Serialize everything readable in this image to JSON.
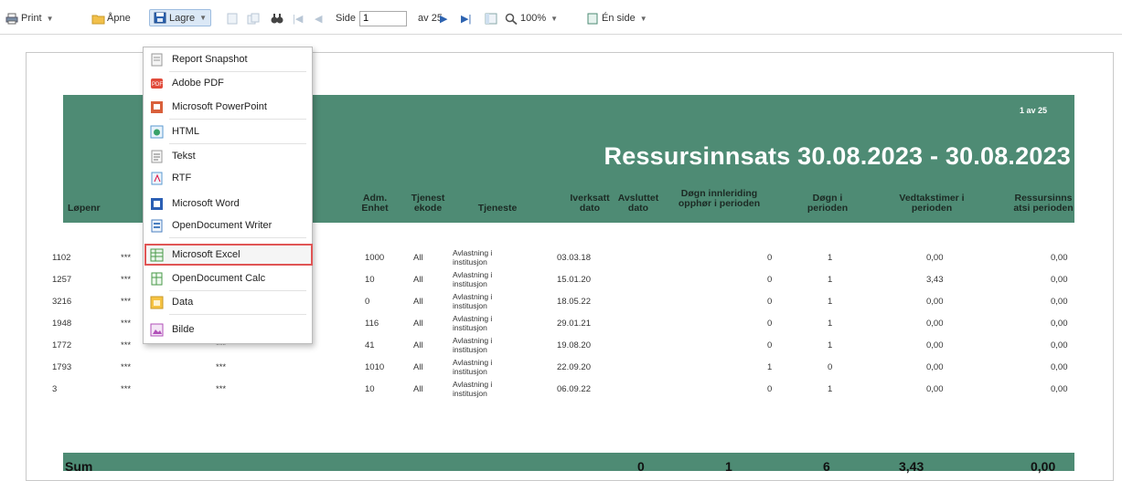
{
  "toolbar": {
    "print_label": "Print",
    "open_label": "Åpne",
    "save_label": "Lagre",
    "page_prefix": "Side",
    "page_value": "1",
    "page_of": "av 25",
    "zoom_label": "100%",
    "view_label": "Én side"
  },
  "export_menu": {
    "items": [
      {
        "label": "Report Snapshot",
        "icon": "snapshot-icon"
      },
      {
        "label": "Adobe PDF",
        "icon": "pdf-icon"
      },
      {
        "label": "Microsoft PowerPoint",
        "icon": "powerpoint-icon"
      },
      {
        "label": "HTML",
        "icon": "html-icon"
      },
      {
        "label": "Tekst",
        "icon": "text-icon"
      },
      {
        "label": "RTF",
        "icon": "rtf-icon"
      },
      {
        "label": "Microsoft Word",
        "icon": "word-icon"
      },
      {
        "label": "OpenDocument Writer",
        "icon": "odt-icon"
      },
      {
        "label": "Microsoft Excel",
        "icon": "excel-icon"
      },
      {
        "label": "OpenDocument Calc",
        "icon": "ods-icon"
      },
      {
        "label": "Data",
        "icon": "data-icon"
      },
      {
        "label": "Bilde",
        "icon": "image-icon"
      }
    ]
  },
  "report": {
    "page_indicator": "1 av 25",
    "title": "Ressursinnsats 30.08.2023 - 30.08.2023",
    "columns": {
      "lopenr": "Løpenr",
      "adm_enhet": "Adm. Enhet",
      "tjenestekode": "Tjenest ekode",
      "tjeneste": "Tjeneste",
      "iverksatt": "Iverksatt dato",
      "avsluttet": "Avsluttet dato",
      "dogn_opphor": "Døgn innleriding opphør i perioden",
      "dogn_perioden": "Døgn i perioden",
      "vedtakstimer": "Vedtakstimer i perioden",
      "ressursinnsats": "Ressursinns atsi perioden"
    },
    "rows": [
      {
        "lopenr": "1102",
        "c2": "***",
        "c3": "",
        "adm": "1000",
        "kode": "All",
        "tj": "Avlastning i institusjon",
        "ivd": "03.03.18",
        "avd": "",
        "opph": "0",
        "dogn": "1",
        "vt": "0,00",
        "ri": "0,00"
      },
      {
        "lopenr": "1257",
        "c2": "***",
        "c3": "",
        "adm": "10",
        "kode": "All",
        "tj": "Avlastning i institusjon",
        "ivd": "15.01.20",
        "avd": "",
        "opph": "0",
        "dogn": "1",
        "vt": "3,43",
        "ri": "0,00"
      },
      {
        "lopenr": "3216",
        "c2": "***",
        "c3": "",
        "adm": "0",
        "kode": "All",
        "tj": "Avlastning i institusjon",
        "ivd": "18.05.22",
        "avd": "",
        "opph": "0",
        "dogn": "1",
        "vt": "0,00",
        "ri": "0,00"
      },
      {
        "lopenr": "1948",
        "c2": "***",
        "c3": "***",
        "adm": "116",
        "kode": "All",
        "tj": "Avlastning i institusjon",
        "ivd": "29.01.21",
        "avd": "",
        "opph": "0",
        "dogn": "1",
        "vt": "0,00",
        "ri": "0,00"
      },
      {
        "lopenr": "1772",
        "c2": "***",
        "c3": "***",
        "adm": "41",
        "kode": "All",
        "tj": "Avlastning i institusjon",
        "ivd": "19.08.20",
        "avd": "",
        "opph": "0",
        "dogn": "1",
        "vt": "0,00",
        "ri": "0,00"
      },
      {
        "lopenr": "1793",
        "c2": "***",
        "c3": "***",
        "adm": "1010",
        "kode": "All",
        "tj": "Avlastning i institusjon",
        "ivd": "22.09.20",
        "avd": "",
        "opph": "1",
        "dogn": "0",
        "vt": "0,00",
        "ri": "0,00"
      },
      {
        "lopenr": "3",
        "c2": "***",
        "c3": "***",
        "adm": "10",
        "kode": "All",
        "tj": "Avlastning i institusjon",
        "ivd": "06.09.22",
        "avd": "",
        "opph": "0",
        "dogn": "1",
        "vt": "0,00",
        "ri": "0,00"
      }
    ],
    "sum": {
      "label": "Sum",
      "avsluttet": "0",
      "opph": "1",
      "dogn": "6",
      "vt": "3,43",
      "ri": "0,00"
    }
  },
  "colors": {
    "accent": "#4e8b74",
    "highlight_border": "#e05555",
    "toolbar_active": "#dbe8f6"
  }
}
